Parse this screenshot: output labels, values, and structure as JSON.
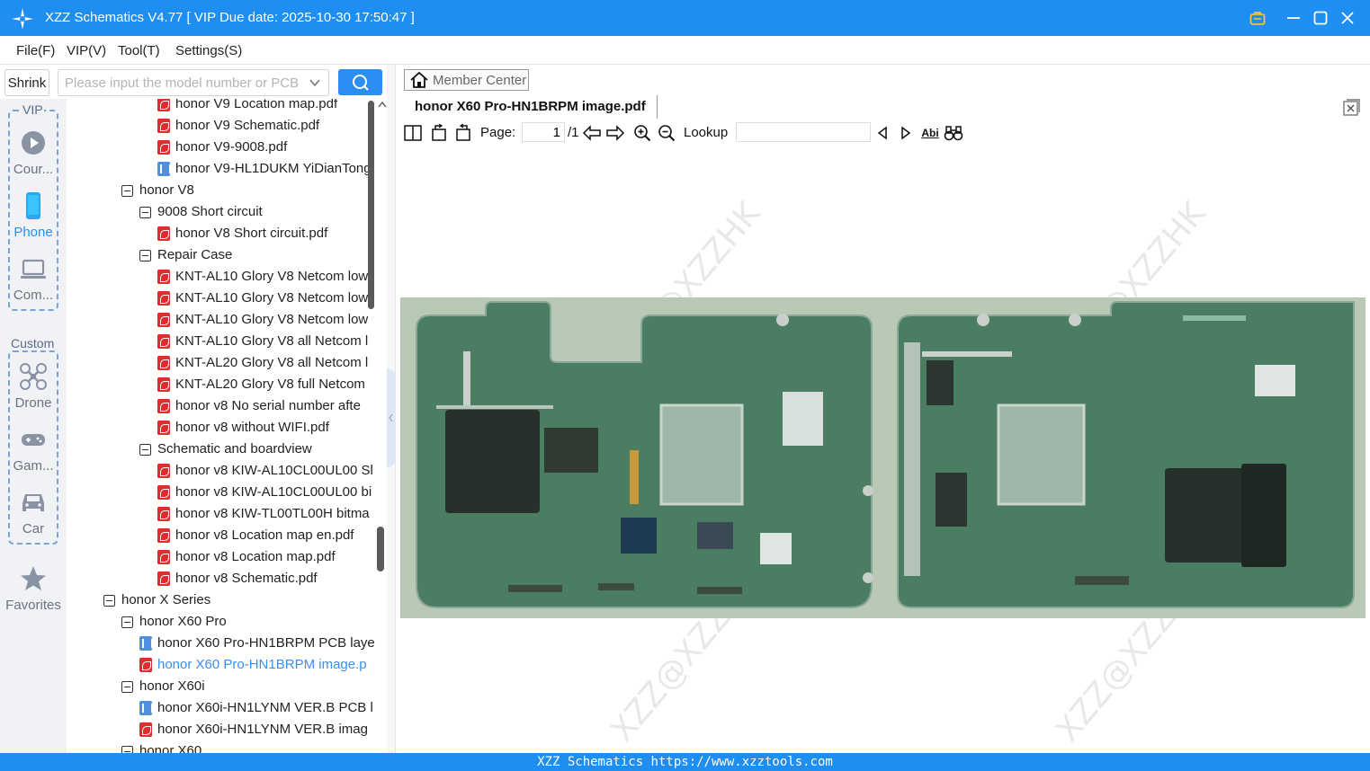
{
  "window": {
    "title": "XZZ Schematics V4.77 [ VIP Due date: 2025-10-30 17:50:47 ]"
  },
  "menu": [
    {
      "label": "File(F)"
    },
    {
      "label": "VIP(V)"
    },
    {
      "label": "Tool(T)"
    },
    {
      "label": "Settings(S)"
    }
  ],
  "search": {
    "shrink_label": "Shrink",
    "placeholder": "Please input the model number or PCB",
    "value": ""
  },
  "categories": {
    "vip_group_label": "VIP",
    "custom_group_label": "Custom",
    "items": [
      {
        "label": "Cour...",
        "icon": "play-circle-icon"
      },
      {
        "label": "Phone",
        "icon": "phone-icon",
        "active": true
      },
      {
        "label": "Com...",
        "icon": "laptop-icon"
      },
      {
        "label": "Drone",
        "icon": "drone-icon"
      },
      {
        "label": "Gam...",
        "icon": "gamepad-icon"
      },
      {
        "label": "Car",
        "icon": "car-icon"
      },
      {
        "label": "Favorites",
        "icon": "star-icon"
      }
    ]
  },
  "tree": {
    "rows": [
      {
        "text": "honor V9 Location map.pdf",
        "kind": "pdf",
        "level": 3
      },
      {
        "text": "honor V9 Schematic.pdf",
        "kind": "pdf",
        "level": 3
      },
      {
        "text": "honor V9-9008.pdf",
        "kind": "pdf",
        "level": 3
      },
      {
        "text": "honor V9-HL1DUKM YiDianTong",
        "kind": "pcb",
        "level": 3
      },
      {
        "text": "honor V8",
        "kind": "folder",
        "level": 1
      },
      {
        "text": "9008 Short circuit",
        "kind": "folder",
        "level": 2
      },
      {
        "text": "honor V8 Short circuit.pdf",
        "kind": "pdf",
        "level": 3
      },
      {
        "text": "Repair Case",
        "kind": "folder",
        "level": 2
      },
      {
        "text": "KNT-AL10 Glory V8 Netcom low",
        "kind": "pdf",
        "level": 3
      },
      {
        "text": "KNT-AL10 Glory V8 Netcom low",
        "kind": "pdf",
        "level": 3
      },
      {
        "text": "KNT-AL10 Glory V8 Netcom low",
        "kind": "pdf",
        "level": 3
      },
      {
        "text": "KNT-AL10 Glory V8 all Netcom l",
        "kind": "pdf",
        "level": 3
      },
      {
        "text": "KNT-AL20 Glory V8 all Netcom l",
        "kind": "pdf",
        "level": 3
      },
      {
        "text": "KNT-AL20 Glory V8 full Netcom",
        "kind": "pdf",
        "level": 3
      },
      {
        "text": "honor v8 No serial number afte",
        "kind": "pdf",
        "level": 3
      },
      {
        "text": "honor v8 without WIFI.pdf",
        "kind": "pdf",
        "level": 3
      },
      {
        "text": "Schematic and boardview",
        "kind": "folder",
        "level": 2
      },
      {
        "text": "honor v8 KIW-AL10CL00UL00 Sl",
        "kind": "pdf",
        "level": 3
      },
      {
        "text": "honor v8 KIW-AL10CL00UL00 bi",
        "kind": "pdf",
        "level": 3
      },
      {
        "text": "honor v8 KIW-TL00TL00H bitma",
        "kind": "pdf",
        "level": 3
      },
      {
        "text": "honor v8 Location map en.pdf",
        "kind": "pdf",
        "level": 3
      },
      {
        "text": "honor v8 Location map.pdf",
        "kind": "pdf",
        "level": 3
      },
      {
        "text": "honor v8 Schematic.pdf",
        "kind": "pdf",
        "level": 3
      },
      {
        "text": "honor X Series",
        "kind": "folder",
        "level": 0
      },
      {
        "text": "honor X60 Pro",
        "kind": "folder",
        "level": 1
      },
      {
        "text": "honor X60 Pro-HN1BRPM PCB laye",
        "kind": "pcb",
        "level": 2
      },
      {
        "text": "honor X60 Pro-HN1BRPM image.p",
        "kind": "pdf",
        "level": 2,
        "selected": true
      },
      {
        "text": "honor X60i",
        "kind": "folder",
        "level": 1
      },
      {
        "text": "honor X60i-HN1LYNM VER.B PCB l",
        "kind": "pcb",
        "level": 2
      },
      {
        "text": "honor X60i-HN1LYNM VER.B imag",
        "kind": "pdf",
        "level": 2
      },
      {
        "text": "honor X60",
        "kind": "folder",
        "level": 1
      }
    ]
  },
  "viewer": {
    "member_center_label": "Member Center",
    "tab_title": "honor X60 Pro-HN1BRPM image.pdf",
    "page_label": "Page:",
    "page_current": "1",
    "page_total": "/1",
    "lookup_label": "Lookup",
    "lookup_value": "",
    "abi_label": "Abi",
    "watermark": "XZZ@XZZHK"
  },
  "statusbar": {
    "text": "XZZ Schematics https://www.xzztools.com"
  },
  "colors": {
    "accent": "#1e8ef3",
    "selected_text": "#3b8fef",
    "pdf_icon": "#d9302f",
    "pcb_board": "#4b7d62"
  }
}
